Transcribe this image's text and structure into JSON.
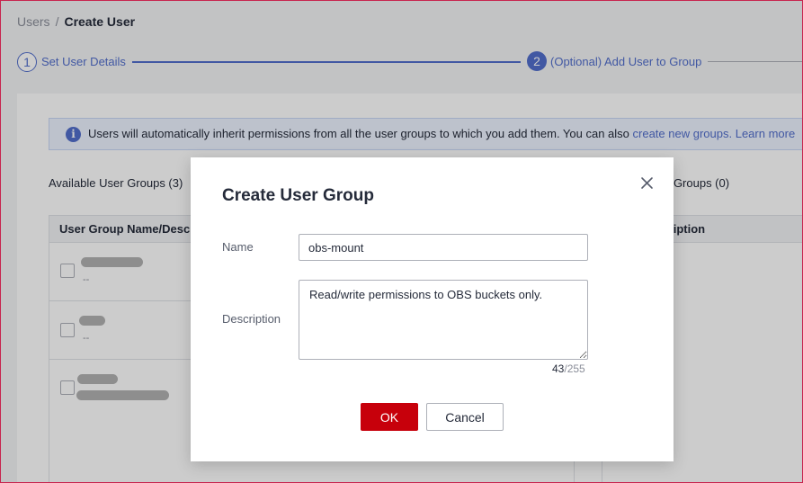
{
  "breadcrumb": {
    "parent": "Users",
    "separator": "/",
    "current": "Create User"
  },
  "steps": [
    {
      "number": "1",
      "label": "Set User Details",
      "state": "completed"
    },
    {
      "number": "2",
      "label": "(Optional) Add User to Group",
      "state": "active"
    }
  ],
  "info": {
    "text": "Users will automatically inherit permissions from all the user groups to which you add them. You can also ",
    "link_create": "create new groups.",
    "link_learn": "Learn more"
  },
  "available": {
    "title": "Available User Groups (3)",
    "column_header": "User Group Name/Description",
    "rows": [
      {
        "description": "--"
      },
      {
        "description": "--"
      },
      {
        "description": ""
      }
    ]
  },
  "selected": {
    "title_visible": "r Groups (0)",
    "column_header_visible": "p Name/Description"
  },
  "dialog": {
    "title": "Create User Group",
    "name_label": "Name",
    "name_value": "obs-mount",
    "description_label": "Description",
    "description_value": "Read/write permissions to OBS buckets only.",
    "char_count_current": "43",
    "char_count_max": "/255",
    "ok_label": "OK",
    "cancel_label": "Cancel",
    "close_icon": "close-icon"
  },
  "colors": {
    "primary": "#526ecc",
    "ok_button": "#c7000b",
    "frame_border": "#c7254e"
  }
}
